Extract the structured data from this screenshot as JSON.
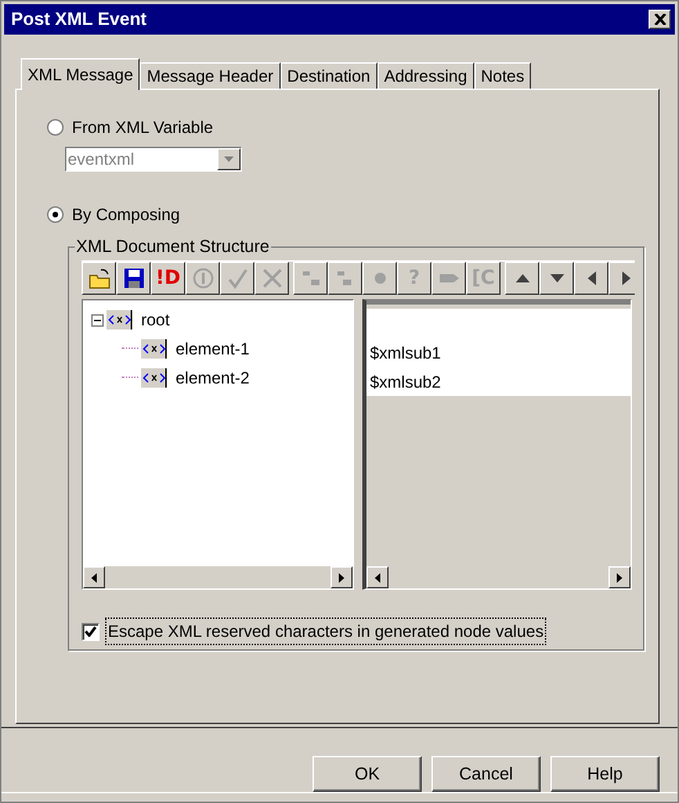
{
  "window": {
    "title": "Post XML Event"
  },
  "tabs": [
    {
      "label": "XML Message",
      "selected": true
    },
    {
      "label": "Message Header",
      "selected": false
    },
    {
      "label": "Destination",
      "selected": false
    },
    {
      "label": "Addressing",
      "selected": false
    },
    {
      "label": "Notes",
      "selected": false
    }
  ],
  "source_options": [
    {
      "label": "From XML Variable",
      "selected": false,
      "dropdown": {
        "value": "eventxml",
        "disabled": true
      }
    },
    {
      "label": "By Composing",
      "selected": true
    }
  ],
  "structure": {
    "title": "XML Document Structure",
    "toolbar": [
      {
        "kind": "open",
        "disabled": false
      },
      {
        "kind": "save",
        "disabled": false
      },
      {
        "kind": "text",
        "label": "!D",
        "disabled": false
      },
      {
        "kind": "info",
        "disabled": true
      },
      {
        "kind": "check",
        "disabled": true
      },
      {
        "kind": "delete",
        "disabled": true
      },
      {
        "kind": "indent",
        "disabled": true,
        "group_start": true
      },
      {
        "kind": "outdent",
        "disabled": true
      },
      {
        "kind": "dot",
        "disabled": true
      },
      {
        "kind": "text",
        "label": "?",
        "disabled": true
      },
      {
        "kind": "tag",
        "disabled": true
      },
      {
        "kind": "text",
        "label": "[C",
        "disabled": true
      },
      {
        "kind": "up",
        "disabled": false,
        "group_start": true
      },
      {
        "kind": "down",
        "disabled": false
      },
      {
        "kind": "left",
        "disabled": false
      },
      {
        "kind": "right",
        "disabled": false
      }
    ],
    "tree": [
      {
        "label": "root",
        "expanded": true,
        "children": [
          {
            "label": "element-1",
            "value": "$xmlsub1"
          },
          {
            "label": "element-2",
            "value": "$xmlsub2"
          }
        ]
      }
    ],
    "escape_checkbox": {
      "label": "Escape XML reserved characters in generated node values",
      "checked": true
    }
  },
  "buttons": [
    "OK",
    "Cancel",
    "Help"
  ]
}
